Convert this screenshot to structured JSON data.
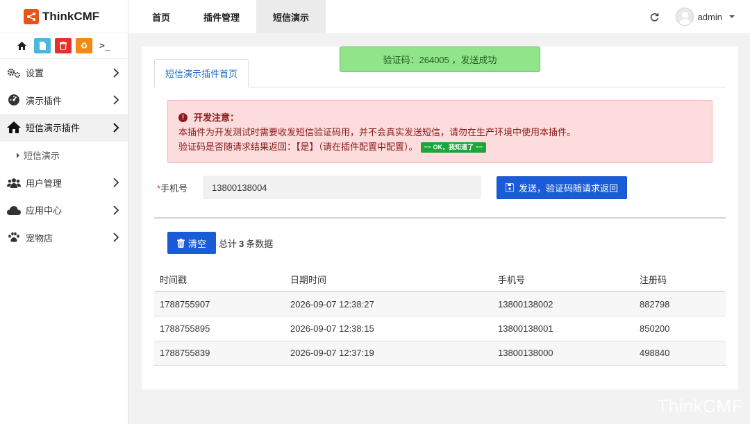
{
  "brand": {
    "name": "ThinkCMF",
    "accent": "#e5551a"
  },
  "quick_tools": [
    "home-icon",
    "file-icon",
    "trash-icon",
    "recycle-icon",
    "terminal-icon"
  ],
  "sidebar": {
    "items": [
      {
        "label": "设置",
        "icon": "gears-icon"
      },
      {
        "label": "演示插件",
        "icon": "dashboard-icon"
      },
      {
        "label": "短信演示插件",
        "icon": "home-icon",
        "active": true
      },
      {
        "label": "短信演示",
        "sub": true
      },
      {
        "label": "用户管理",
        "icon": "users-icon"
      },
      {
        "label": "应用中心",
        "icon": "cloud-icon"
      },
      {
        "label": "宠物店",
        "icon": "paw-icon"
      }
    ]
  },
  "topbar": {
    "tabs": [
      "首页",
      "插件管理",
      "短信演示"
    ],
    "active_tab": "短信演示",
    "user": "admin"
  },
  "toast": {
    "text": "验证码：264005 ，发送成功"
  },
  "panel": {
    "tab": "短信演示插件首页",
    "alert": {
      "title": "开发注意：",
      "line1": "本插件为开发测试时需要收发短信验证码用，并不会真实发送短信，请勿在生产环境中使用本插件。",
      "line2": "验证码是否随请求结果返回：【是】（请在插件配置中配置）。",
      "badge": "~~ OK，我知道了 ~~"
    },
    "form": {
      "required_mark": "*",
      "label": "手机号",
      "phone_value": "13800138004",
      "send_label": "发送，验证码随请求返回"
    },
    "clear_label": "清空",
    "total": {
      "prefix": "总计",
      "count": "3",
      "suffix": "条数据"
    },
    "table": {
      "headers": [
        "时间戳",
        "日期时间",
        "手机号",
        "注册码"
      ],
      "rows": [
        [
          "1788755907",
          "2026-09-07 12:38:27",
          "13800138002",
          "882798"
        ],
        [
          "1788755895",
          "2026-09-07 12:38:15",
          "13800138001",
          "850200"
        ],
        [
          "1788755839",
          "2026-09-07 12:37:19",
          "13800138000",
          "498840"
        ]
      ]
    }
  },
  "watermark": "ThinkCMF"
}
